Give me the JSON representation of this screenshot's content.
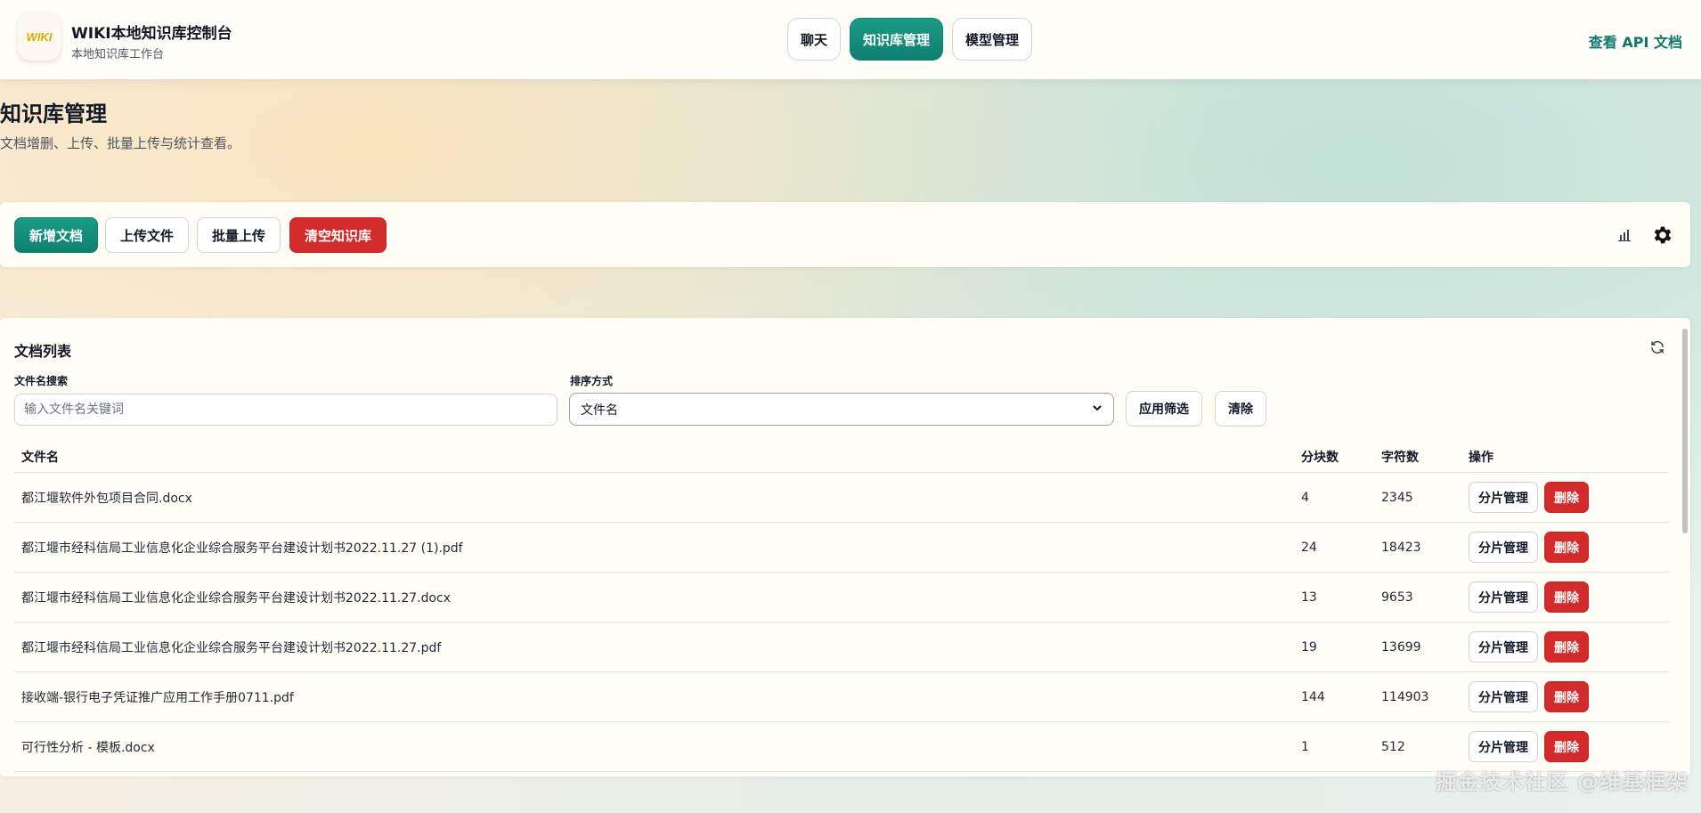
{
  "header": {
    "logo_text": "WIKI",
    "title": "WIKI本地知识库控制台",
    "subtitle": "本地知识库工作台",
    "nav": [
      {
        "label": "聊天",
        "active": false
      },
      {
        "label": "知识库管理",
        "active": true
      },
      {
        "label": "模型管理",
        "active": false
      }
    ],
    "api_link": "查看 API 文档"
  },
  "page": {
    "title": "知识库管理",
    "description": "文档增删、上传、批量上传与统计查看。"
  },
  "toolbar": {
    "new_doc": "新增文档",
    "upload": "上传文件",
    "batch_upload": "批量上传",
    "clear_kb": "清空知识库",
    "icons": [
      "chart-icon",
      "gear-icon"
    ]
  },
  "doc_list": {
    "title": "文档列表",
    "search_label": "文件名搜索",
    "search_placeholder": "输入文件名关键词",
    "search_value": "",
    "sort_label": "排序方式",
    "sort_value": "文件名",
    "apply_filter": "应用筛选",
    "clear": "清除",
    "columns": {
      "name": "文件名",
      "chunks": "分块数",
      "chars": "字符数",
      "ops": "操作"
    },
    "op_manage": "分片管理",
    "op_delete": "删除",
    "rows": [
      {
        "name": "都江堰软件外包项目合同.docx",
        "chunks": "4",
        "chars": "2345"
      },
      {
        "name": "都江堰市经科信局工业信息化企业综合服务平台建设计划书2022.11.27 (1).pdf",
        "chunks": "24",
        "chars": "18423"
      },
      {
        "name": "都江堰市经科信局工业信息化企业综合服务平台建设计划书2022.11.27.docx",
        "chunks": "13",
        "chars": "9653"
      },
      {
        "name": "都江堰市经科信局工业信息化企业综合服务平台建设计划书2022.11.27.pdf",
        "chunks": "19",
        "chars": "13699"
      },
      {
        "name": "接收端-银行电子凭证推广应用工作手册0711.pdf",
        "chunks": "144",
        "chars": "114903"
      },
      {
        "name": "可行性分析 - 模板.docx",
        "chunks": "1",
        "chars": "512"
      }
    ]
  },
  "watermark": "掘金技术社区 @维基框架",
  "colors": {
    "accent": "#0f7f70",
    "danger": "#d32b2b",
    "link": "#0f766e"
  }
}
